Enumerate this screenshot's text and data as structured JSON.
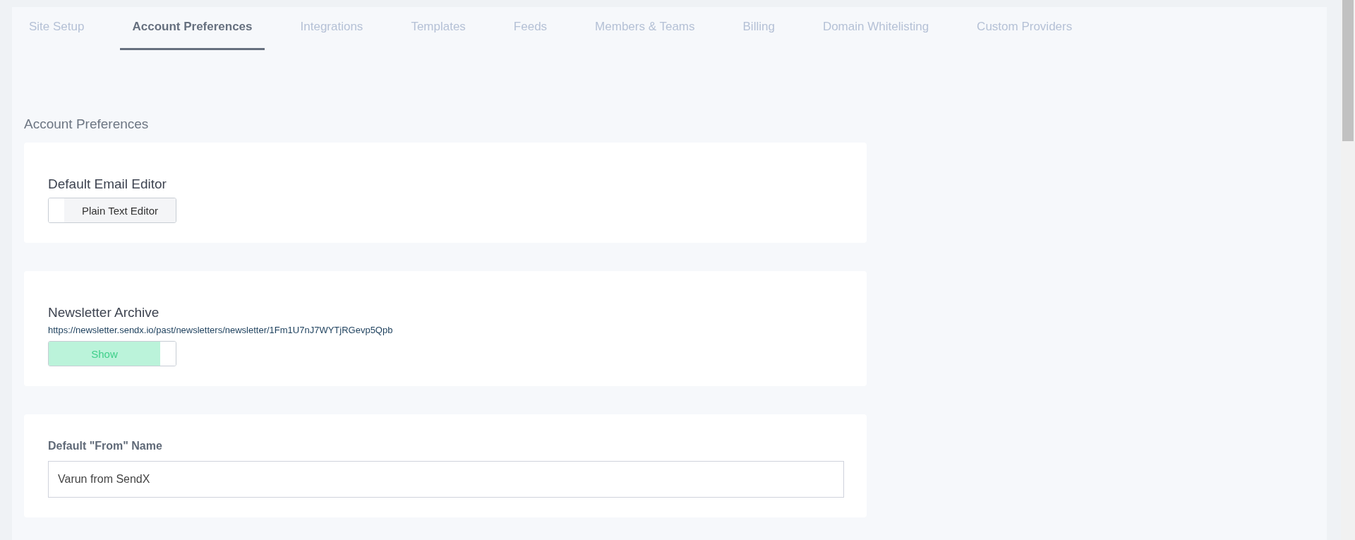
{
  "tabs": [
    {
      "label": "Site Setup",
      "selected": false
    },
    {
      "label": "Account Preferences",
      "selected": true
    },
    {
      "label": "Integrations",
      "selected": false
    },
    {
      "label": "Templates",
      "selected": false
    },
    {
      "label": "Feeds",
      "selected": false
    },
    {
      "label": "Members & Teams",
      "selected": false
    },
    {
      "label": "Billing",
      "selected": false
    },
    {
      "label": "Domain Whitelisting",
      "selected": false
    },
    {
      "label": "Custom Providers",
      "selected": false
    }
  ],
  "section_title": "Account Preferences",
  "cards": [
    {
      "kind": "toggle",
      "title": "Default Email Editor",
      "toggle": {
        "label": "Plain Text Editor",
        "on": false
      }
    },
    {
      "kind": "toggle",
      "title": "Newsletter Archive",
      "link": "https://newsletter.sendx.io/past/newsletters/newsletter/1Fm1U7nJ7WYTjRGevp5Qpb",
      "toggle": {
        "label": "Show",
        "on": true
      }
    },
    {
      "kind": "field",
      "title": "Default \"From\" Name",
      "value": "Varun from SendX"
    }
  ]
}
